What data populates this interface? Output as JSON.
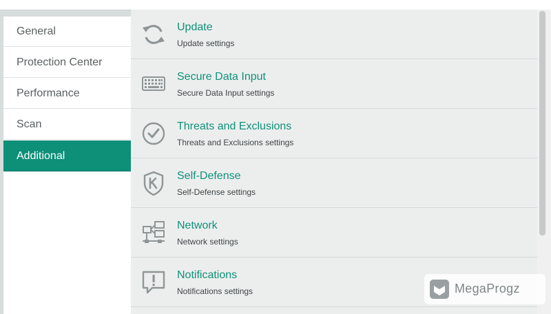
{
  "sidebar": {
    "items": [
      {
        "label": "General",
        "active": false
      },
      {
        "label": "Protection Center",
        "active": false
      },
      {
        "label": "Performance",
        "active": false
      },
      {
        "label": "Scan",
        "active": false
      },
      {
        "label": "Additional",
        "active": true
      }
    ]
  },
  "main": {
    "items": [
      {
        "title": "Update",
        "subtitle": "Update settings",
        "icon": "refresh-icon"
      },
      {
        "title": "Secure Data Input",
        "subtitle": "Secure Data Input settings",
        "icon": "keyboard-icon"
      },
      {
        "title": "Threats and Exclusions",
        "subtitle": "Threats and Exclusions settings",
        "icon": "checkmark-circle-icon"
      },
      {
        "title": "Self-Defense",
        "subtitle": "Self-Defense settings",
        "icon": "shield-icon"
      },
      {
        "title": "Network",
        "subtitle": "Network settings",
        "icon": "network-icon"
      },
      {
        "title": "Notifications",
        "subtitle": "Notifications settings",
        "icon": "notification-icon"
      }
    ]
  },
  "watermark": {
    "text": "MegaProgz"
  },
  "colors": {
    "accent": "#0f9079",
    "active_bg": "#0d8f78",
    "content_bg": "#eceeee",
    "icon": "#8f9596"
  }
}
